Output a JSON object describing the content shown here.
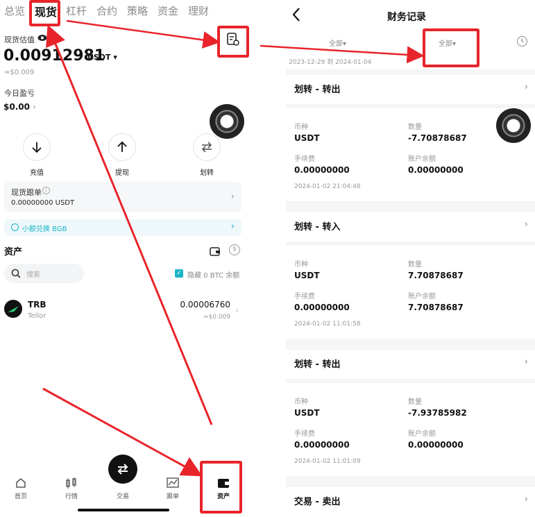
{
  "left": {
    "tabs": [
      "总览",
      "现货",
      "杠杆",
      "合约",
      "策略",
      "资金",
      "理财"
    ],
    "active_tab": "现货",
    "valuation_label": "现货估值",
    "balance": "0.00912981",
    "balance_unit": "USDT",
    "balance_usd": "≈$0.009",
    "pnl_label": "今日盈亏",
    "pnl_value": "$0.00",
    "actions": [
      {
        "label": "充值",
        "icon": "arrow-down-icon"
      },
      {
        "label": "提现",
        "icon": "arrow-up-icon"
      },
      {
        "label": "划转",
        "icon": "transfer-icon"
      }
    ],
    "copy_card": {
      "title": "现货跟单",
      "value": "0.00000000 USDT"
    },
    "exchange_text": "小额兑换 BGB",
    "assets_title": "资产",
    "search_placeholder": "搜索",
    "hide_label": "隐藏 0 BTC 余额",
    "asset": {
      "symbol": "TRB",
      "name": "Tellor",
      "amount": "0.00006760",
      "usd": "≈$0.009"
    },
    "nav": [
      {
        "label": "首页",
        "icon": "home-icon"
      },
      {
        "label": "行情",
        "icon": "candlestick-icon"
      },
      {
        "label": "交易",
        "icon": "swap-icon"
      },
      {
        "label": "跟单",
        "icon": "chart-icon"
      },
      {
        "label": "资产",
        "icon": "wallet-icon"
      }
    ]
  },
  "right": {
    "title": "财务记录",
    "filter1": "全部",
    "filter2": "全部",
    "date_from": "2023-12-29",
    "date_to_word": "到",
    "date_to": "2024-01-04",
    "field_labels": {
      "coin": "币种",
      "qty": "数量",
      "fee": "手续费",
      "balance": "账户余额"
    },
    "records": [
      {
        "title": "划转 - 转出",
        "coin": "USDT",
        "qty": "-7.70878687",
        "fee": "0.00000000",
        "balance": "0.00000000",
        "time": "2024-01-02 21:04:48"
      },
      {
        "title": "划转 - 转入",
        "coin": "USDT",
        "qty": "7.70878687",
        "fee": "0.00000000",
        "balance": "7.70878687",
        "time": "2024-01-02 11:01:58"
      },
      {
        "title": "划转 - 转出",
        "coin": "USDT",
        "qty": "-7.93785982",
        "fee": "0.00000000",
        "balance": "0.00000000",
        "time": "2024-01-02 11:01:09"
      },
      {
        "title": "交易 - 卖出"
      }
    ]
  },
  "colors": {
    "highlight": "#e8242b",
    "accent": "#1bb5c7"
  }
}
